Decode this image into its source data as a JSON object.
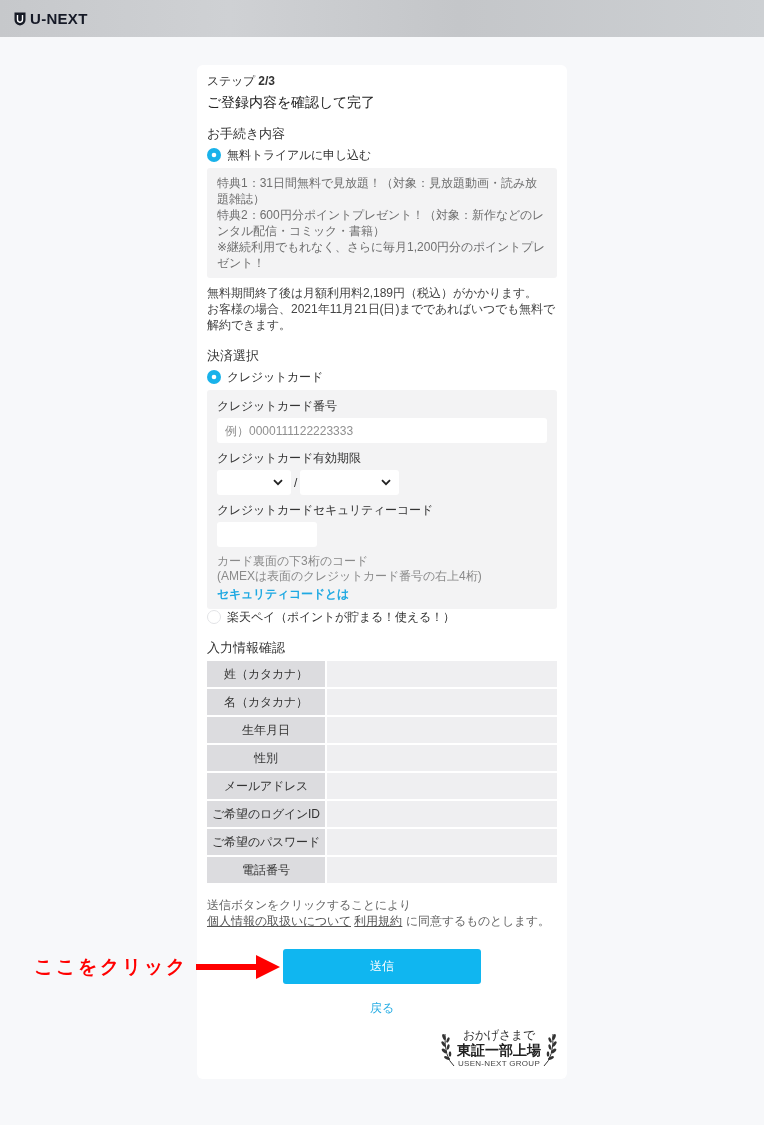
{
  "header": {
    "logo": "U-NEXT"
  },
  "step": "ステップ **2/3**",
  "title": "ご登録内容を確認して完了",
  "procedure": {
    "heading": "お手続き内容",
    "options": [
      {
        "label": "無料トライアルに申し込む",
        "selected": true
      }
    ],
    "benefits": [
      "特典1：31日間無料で見放題！（対象：見放題動画・読み放題雑誌）",
      "特典2：600円分ポイントプレゼント！（対象：新作などのレンタル配信・コミック・書籍）",
      "※継続利用でもれなく、さらに毎月1,200円分のポイントプレゼント！"
    ],
    "notes": [
      "無料期間終了後は月額利用料2,189円（税込）がかかります。",
      "お客様の場合、2021年11月21日(日)までであればいつでも無料で解約できます。"
    ]
  },
  "payment": {
    "heading": "決済選択",
    "methods": [
      {
        "kind": "card",
        "label": "クレジットカード",
        "selected": true,
        "fields": [
          {
            "kind": "text",
            "label": "クレジットカード番号",
            "placeholder": "例）0000111122223333"
          },
          {
            "kind": "expiry",
            "label": "クレジットカード有効期限",
            "separator": "/"
          },
          {
            "kind": "code",
            "label": "クレジットカードセキュリティーコード"
          }
        ],
        "hints": [
          "カード裏面の下3桁のコード",
          "(AMEXは表面のクレジットカード番号の右上4桁)"
        ],
        "link": "セキュリティコードとは"
      },
      {
        "kind": "simple",
        "label": "楽天ペイ（ポイントが貯まる！使える！）",
        "selected": false
      }
    ]
  },
  "confirmation": {
    "heading": "入力情報確認",
    "rows": [
      {
        "label": "姓（カタカナ）"
      },
      {
        "label": "名（カタカナ）"
      },
      {
        "label": "生年月日"
      },
      {
        "label": "性別"
      },
      {
        "label": "メールアドレス"
      },
      {
        "label": "ご希望のログインID"
      },
      {
        "label": "ご希望のパスワード"
      },
      {
        "label": "電話番号"
      }
    ]
  },
  "agreement": {
    "before": "送信ボタンをクリックすることにより",
    "links": [
      "個人情報の取扱いについて",
      "利用規約"
    ],
    "after": "に同意するものとします。"
  },
  "submit": "送信",
  "back": "戻る",
  "badge": {
    "top": "おかげさまで",
    "main": "東証一部上場",
    "bottom": "USEN-NEXT GROUP"
  },
  "annotation": {
    "text": "ここをクリック"
  }
}
